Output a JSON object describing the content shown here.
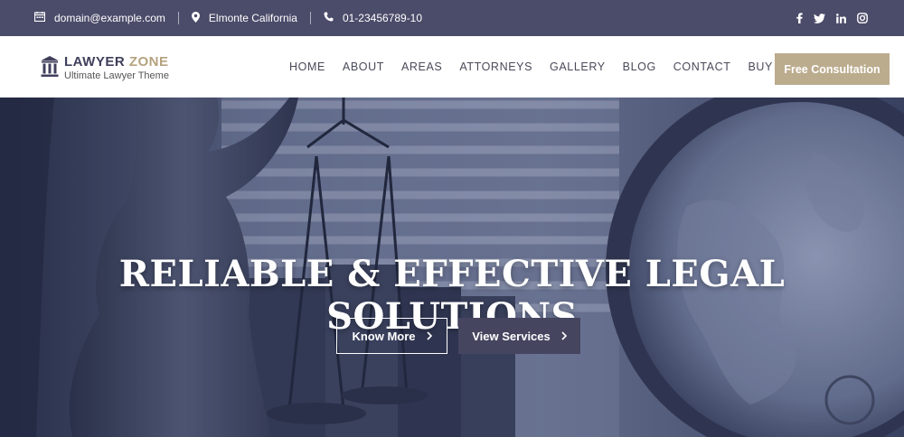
{
  "topbar": {
    "email": "domain@example.com",
    "location": "Elmonte California",
    "phone": "01-23456789-10",
    "social": [
      "facebook-icon",
      "twitter-icon",
      "linkedin-icon",
      "instagram-icon"
    ]
  },
  "header": {
    "logo_name_main": "LAWYER ",
    "logo_name_accent": "ZONE",
    "logo_tagline": "Ultimate Lawyer Theme",
    "nav": [
      "HOME",
      "ABOUT",
      "AREAS",
      "ATTORNEYS",
      "GALLERY",
      "BLOG",
      "CONTACT",
      "BUY PRO"
    ],
    "cta_label": "Free Consultation"
  },
  "hero": {
    "title": "RELIABLE & EFFECTIVE LEGAL SOLUTIONS",
    "primary_button": "Know More",
    "secondary_button": "View Services"
  },
  "colors": {
    "topbar_bg": "#4b4b6a",
    "accent_gold": "#bcac8e",
    "button_dark": "#454560"
  }
}
